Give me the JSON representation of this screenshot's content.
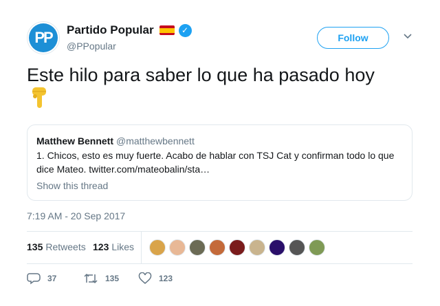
{
  "header": {
    "avatar_text": "PP",
    "display_name": "Partido Popular",
    "handle": "@PPopular",
    "follow_label": "Follow",
    "icons": [
      "spain-flag-icon",
      "verified-badge-icon",
      "chevron-down-icon"
    ]
  },
  "tweet": {
    "text": "Este hilo para saber lo que ha pasado hoy",
    "emoji_icon": "pointing-down-hand-icon"
  },
  "quote": {
    "name": "Matthew Bennett",
    "handle": "@matthewbennett",
    "text": "1. Chicos, esto es muy fuerte. Acabo de hablar con TSJ Cat y confirman todo lo que dice Mateo. twitter.com/mateobalin/sta…",
    "show_thread": "Show this thread"
  },
  "timestamp": "7:19 AM - 20 Sep 2017",
  "stats": {
    "retweets_count": "135",
    "retweets_label": "Retweets",
    "likes_count": "123",
    "likes_label": "Likes",
    "liker_colors": [
      "#d9a44a",
      "#e8b896",
      "#6b6b55",
      "#c46a3a",
      "#7a1c1c",
      "#c9b48e",
      "#2a0f6a",
      "#555555",
      "#7f9a55"
    ]
  },
  "actions": {
    "reply_count": "37",
    "retweet_count": "135",
    "like_count": "123"
  },
  "colors": {
    "accent": "#1da1f2",
    "muted": "#657786",
    "border": "#e1e8ed"
  }
}
